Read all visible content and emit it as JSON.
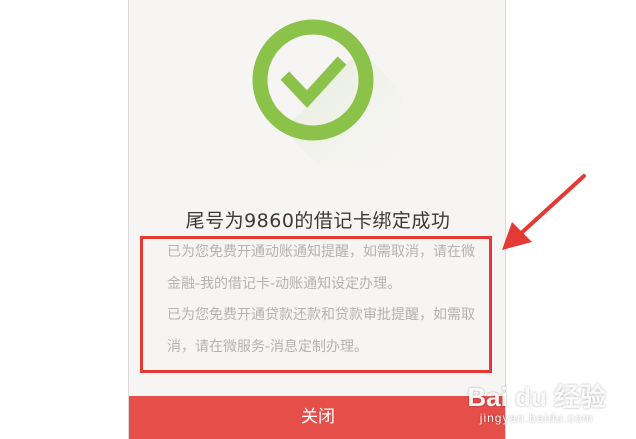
{
  "dialog": {
    "title": "尾号为9860的借记卡绑定成功",
    "notice_paragraph_1": "已为您免费开通动账通知提醒，如需取消，请在微金融-我的借记卡-动账通知设定办理。",
    "notice_paragraph_2": "已为您免费开通贷款还款和贷款审批提醒，如需取消，请在微服务-消息定制办理。",
    "close_label": "关闭"
  },
  "watermark": {
    "brand": "Bai du 经验",
    "url": "jingyan.baidu.com"
  },
  "colors": {
    "success_green": "#8bc34a",
    "close_button": "#e64e4a",
    "highlight_red": "#e53935",
    "panel_background": "#f6f5f3"
  },
  "icons": {
    "success": "check-circle-icon",
    "annotation_arrow": "arrow-icon"
  }
}
